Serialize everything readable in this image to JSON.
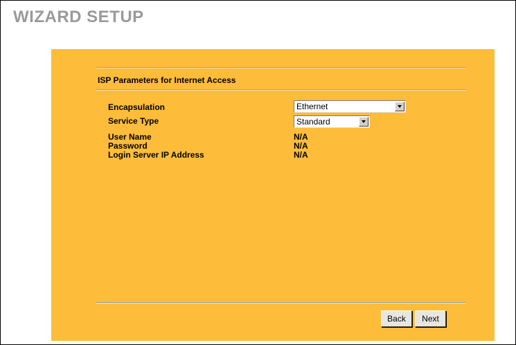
{
  "wizard": {
    "title": "WIZARD SETUP"
  },
  "section": {
    "title": "ISP Parameters for Internet Access"
  },
  "fields": {
    "encapsulation": {
      "label": "Encapsulation",
      "value": "Ethernet"
    },
    "service_type": {
      "label": "Service Type",
      "value": "Standard"
    },
    "user_name": {
      "label": "User Name",
      "value": "N/A"
    },
    "password": {
      "label": "Password",
      "value": "N/A"
    },
    "login_server": {
      "label": "Login Server IP Address",
      "value": "N/A"
    }
  },
  "buttons": {
    "back": "Back",
    "next": "Next"
  },
  "colors": {
    "panel": "#fdbc3a",
    "title_gray": "#9a9a9a",
    "rule": "#9a9a9a"
  }
}
